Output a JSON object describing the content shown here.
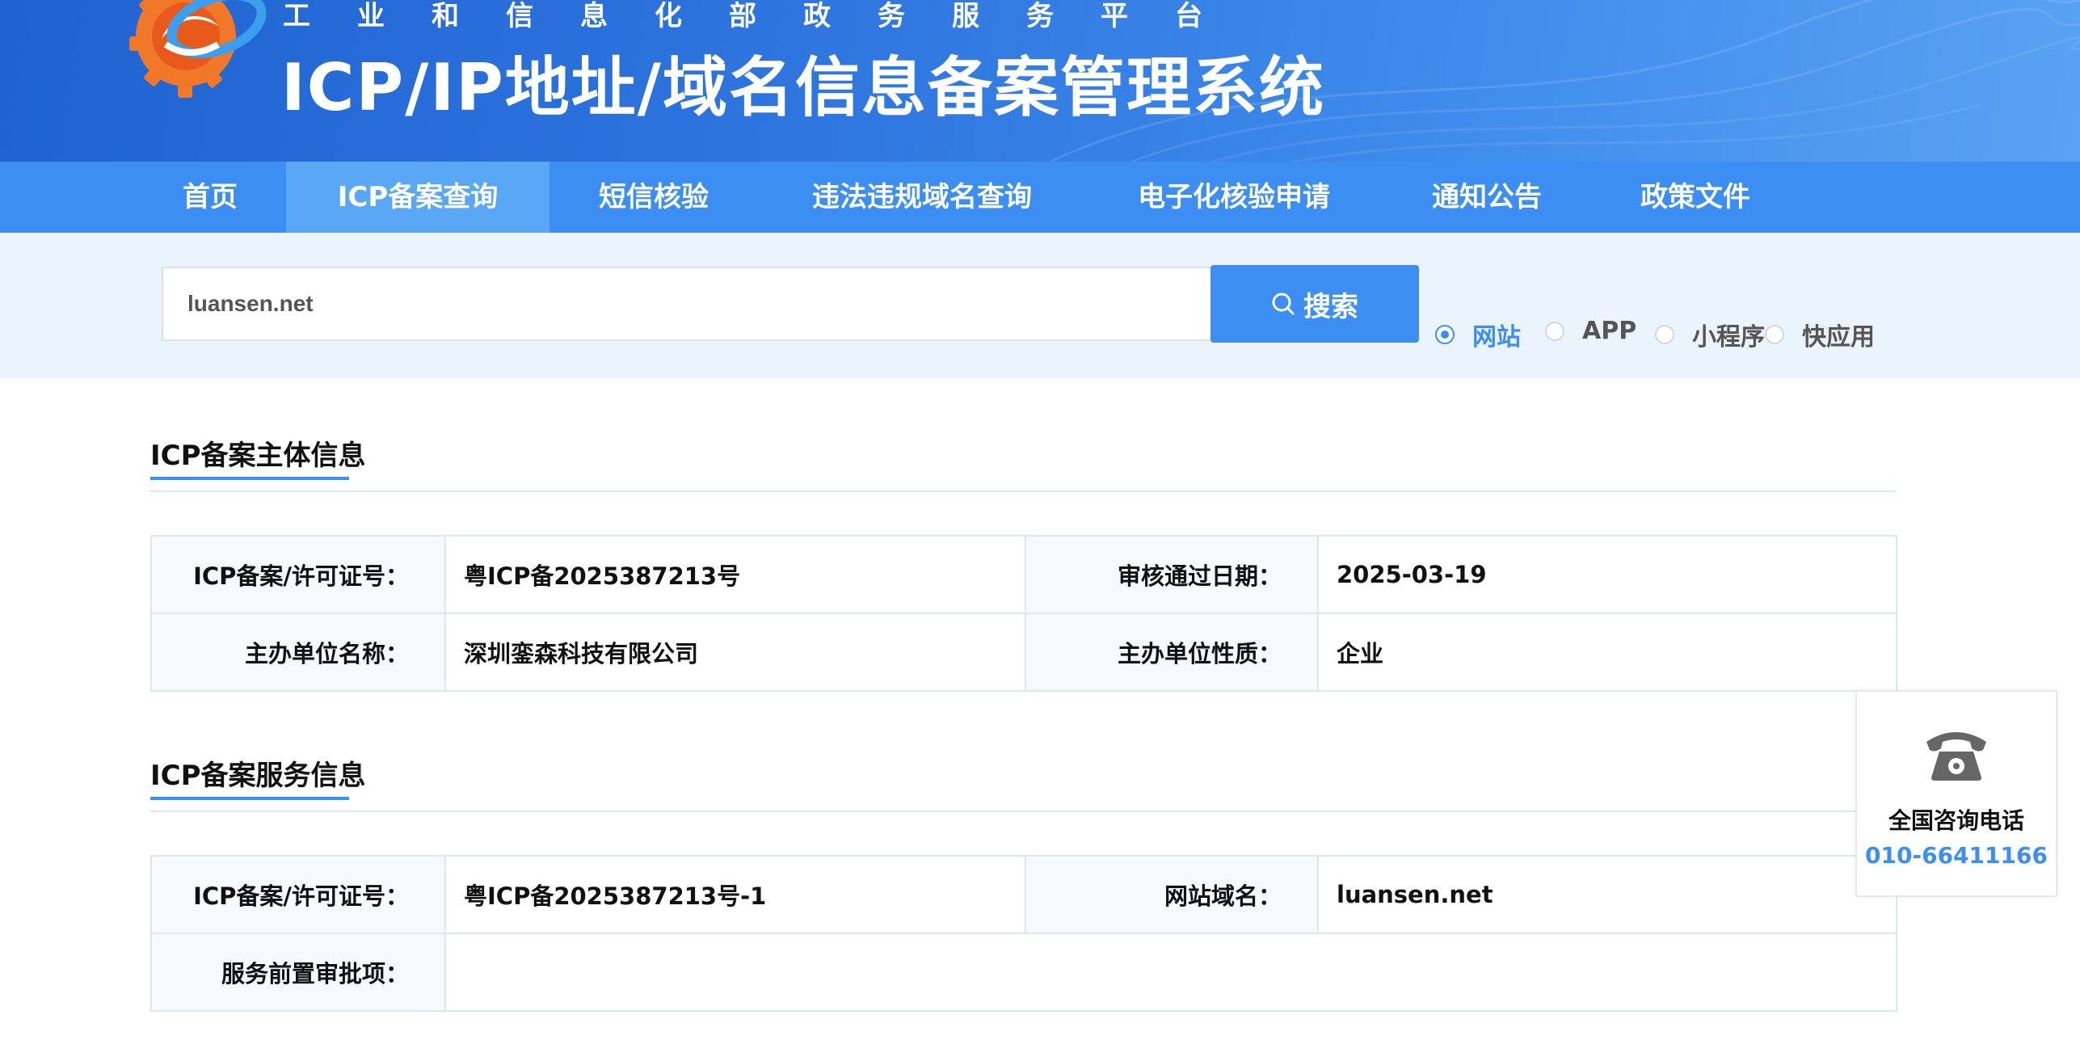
{
  "header": {
    "platform_name": "工业和信息化部政务服务平台",
    "system_title": "ICP/IP地址/域名信息备案管理系统",
    "logo_icon": "e-gear-logo-icon"
  },
  "nav": {
    "items": [
      {
        "label": "首页"
      },
      {
        "label": "ICP备案查询",
        "active": true
      },
      {
        "label": "短信核验"
      },
      {
        "label": "违法违规域名查询"
      },
      {
        "label": "电子化核验申请"
      },
      {
        "label": "通知公告"
      },
      {
        "label": "政策文件"
      }
    ]
  },
  "search": {
    "value": "luansen.net",
    "button_label": "搜索",
    "button_icon": "search-icon",
    "types": [
      {
        "label": "网站",
        "checked": true
      },
      {
        "label": "APP"
      },
      {
        "label": "小程序"
      },
      {
        "label": "快应用"
      }
    ]
  },
  "subject_info": {
    "title": "ICP备案主体信息",
    "rows": [
      {
        "label1": "ICP备案/许可证号：",
        "value1": "粤ICP备2025387213号",
        "label2": "审核通过日期：",
        "value2": "2025-03-19"
      },
      {
        "label1": "主办单位名称：",
        "value1": "深圳銮森科技有限公司",
        "label2": "主办单位性质：",
        "value2": "企业"
      }
    ]
  },
  "service_info": {
    "title": "ICP备案服务信息",
    "row1": {
      "label1": "ICP备案/许可证号：",
      "value1": "粤ICP备2025387213号-1",
      "label2": "网站域名：",
      "value2": "luansen.net"
    },
    "row2": {
      "label1": "服务前置审批项：",
      "value1": ""
    }
  },
  "contact": {
    "label": "全国咨询电话",
    "phone": "010-66411166",
    "icon": "telephone-icon"
  },
  "colors": {
    "primary": "#3d8ef2",
    "nav_active": "#5aa7f6",
    "search_bg": "#ebf3fc"
  }
}
